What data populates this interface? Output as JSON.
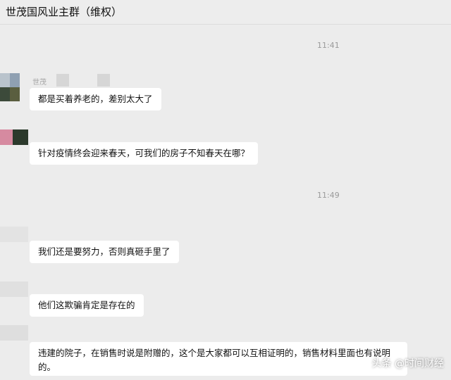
{
  "chat": {
    "title": "世茂国风业主群（维权）",
    "times": [
      "11:41",
      "11:49"
    ],
    "sender_name": "世茂",
    "messages": [
      "都是买着养老的，差别太大了",
      "针对疫情终会迎来春天，可我们的房子不知春天在哪？",
      "我们还是要努力，否则真砸手里了",
      "他们这欺骗肯定是存在的",
      "违建的院子，在销售时说是附赠的，这个是大家都可以互相证明的，销售材料里面也有说明的。"
    ]
  },
  "watermark": "头条 @时间财经",
  "colors": {
    "background": "#ececec",
    "bubble": "#ffffff",
    "timestamp": "#9a9a9a"
  }
}
